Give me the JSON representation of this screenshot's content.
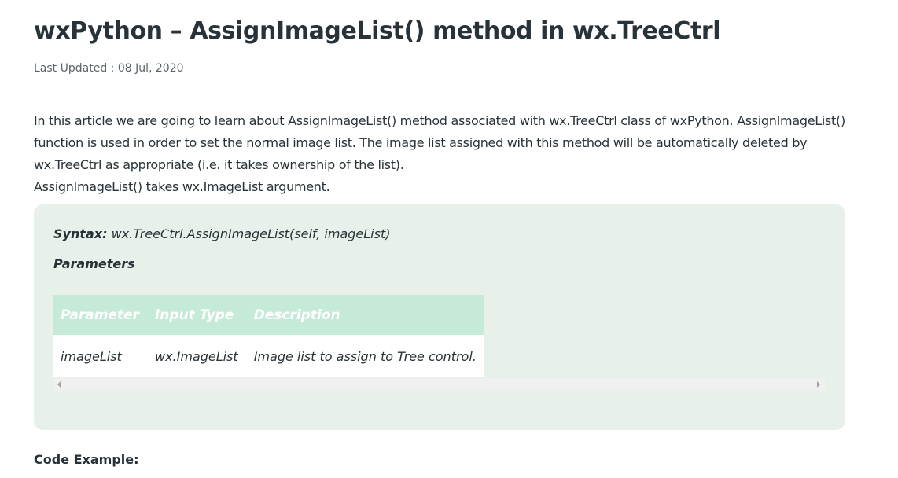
{
  "article": {
    "title": "wxPython – AssignImageList() method in wx.TreeCtrl",
    "updated_label": "Last Updated : ",
    "updated_date": "08 Jul, 2020",
    "intro_p1": "In this article we are going to learn about AssignImageList() method associated with wx.TreeCtrl class of wxPython. AssignImageList() function is used in order to set the normal image list. The image list assigned with this method will be automatically deleted by wx.TreeCtrl as appropriate (i.e. it takes ownership of the list).",
    "intro_p2": "AssignImageList() takes wx.ImageList argument."
  },
  "syntax": {
    "label": "Syntax:",
    "signature": " wx.TreeCtrl.AssignImageList(self, imageList)",
    "params_title": "Parameters"
  },
  "params_table": {
    "headers": [
      "Parameter",
      "Input Type",
      "Description"
    ],
    "rows": [
      [
        "imageList",
        "wx.ImageList",
        "Image list to assign to Tree control."
      ]
    ]
  },
  "code_heading": "Code Example:",
  "colors": {
    "text": "#273239",
    "box_bg": "#e7f1ea",
    "table_header_bg": "#c6ead8"
  }
}
